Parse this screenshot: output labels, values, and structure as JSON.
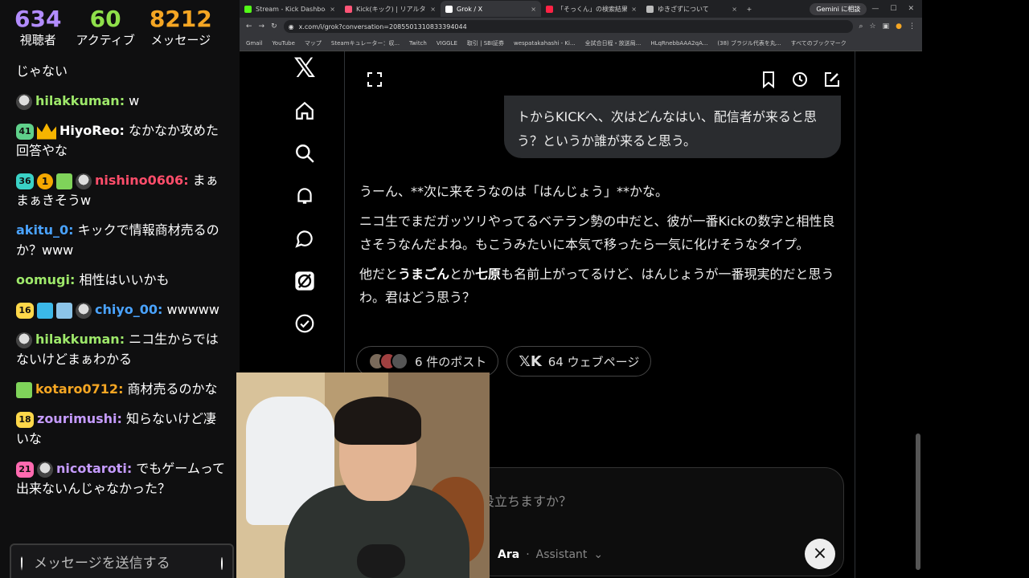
{
  "stats": [
    {
      "value": "634",
      "label": "視聴者",
      "color": "#b28cff"
    },
    {
      "value": "60",
      "label": "アクティブ",
      "color": "#8fe04a"
    },
    {
      "value": "8212",
      "label": "メッセージ",
      "color": "#f5a623"
    }
  ],
  "chat": {
    "messages": [
      {
        "name": "",
        "name_color": "#ffffff",
        "badges": [],
        "text": "じゃない"
      },
      {
        "name": "hilakkuman:",
        "name_color": "#9ee86a",
        "badges": [
          "avatar"
        ],
        "text": " w"
      },
      {
        "name": "HiyoReo:",
        "name_color": "#ffffff",
        "badges": [
          "lvl:41:#5fd08a",
          "crown"
        ],
        "text": " なかなか攻めた回答やな"
      },
      {
        "name": "nishino0606:",
        "name_color": "#ff4d6a",
        "badges": [
          "lvl:36:#3ad1c6",
          "coin:1",
          "gift",
          "avatar"
        ],
        "text": " まぁまぁきそうw"
      },
      {
        "name": "akitu_0:",
        "name_color": "#4aa3ff",
        "badges": [],
        "text": " キックで情報商材売るのか？www"
      },
      {
        "name": "oomugi:",
        "name_color": "#9ee86a",
        "badges": [],
        "text": " 相性はいいかも"
      },
      {
        "name": "chiyo_00:",
        "name_color": "#4aa3ff",
        "badges": [
          "lvl:16:#ffd84a",
          "gift2",
          "gift3",
          "avatar"
        ],
        "text": " wwwww"
      },
      {
        "name": "hilakkuman:",
        "name_color": "#9ee86a",
        "badges": [
          "avatar"
        ],
        "text": " ニコ生からではないけどまぁわかる"
      },
      {
        "name": "kotaro0712:",
        "name_color": "#f5a623",
        "badges": [
          "gift"
        ],
        "text": " 商材売るのかな"
      },
      {
        "name": "zourimushi:",
        "name_color": "#c59bff",
        "badges": [
          "lvl:18:#ffd84a"
        ],
        "text": " 知らないけど凄いな"
      },
      {
        "name": "nicotaroti:",
        "name_color": "#c59bff",
        "badges": [
          "lvl:21:#ff6ab0",
          "avatar"
        ],
        "text": " でもゲームって出来ないんじゃなかった？"
      }
    ],
    "input_placeholder": "メッセージを送信する"
  },
  "browser": {
    "tabs": [
      {
        "label": "Stream - Kick Dashboard",
        "color": "#53fc18",
        "active": false
      },
      {
        "label": "Kick(キック) | リアルタイムランキング",
        "color": "#ff5577",
        "active": false
      },
      {
        "label": "Grok / X",
        "color": "#ffffff",
        "active": true
      },
      {
        "label": "「そっくん」の検索結果 - Yahoo!検索",
        "color": "#ff2244",
        "active": false
      },
      {
        "label": "ゆきざずについて",
        "color": "#bbbbbb",
        "active": false
      }
    ],
    "gemini": "Gemini に相談",
    "url": "x.com/i/grok?conversation=2085501310833394044",
    "bookmarks": [
      "Gmail",
      "YouTube",
      "マップ",
      "Steamキュレーター：収...",
      "Twitch",
      "VIGGLE",
      "取引 | SBI証券",
      "wespatakahashi - Ki...",
      "全試合日程・放送局...",
      "HLqRnebbAAA2qA...",
      "(38) ブラジル代表を丸...",
      "すべてのブックマーク"
    ]
  },
  "grok": {
    "user_bubble": "トからKICKへ、次はどんなはい、配信者が来ると思う？というか誰が来ると思う。",
    "answer_p1": "うーん、**次に来そうなのは「はんじょう」**かな。",
    "answer_p2": "ニコ生でまだガッツリやってるベテラン勢の中だと、彼が一番Kickの数字と相性良さそうなんだよね。もこうみたいに本気で移ったら一気に化けそうなタイプ。",
    "answer_p3_a": "他だと",
    "answer_p3_b1": "うまごん",
    "answer_p3_c": "とか",
    "answer_p3_b2": "七原",
    "answer_p3_d": "も名前上がってるけど、はんじょうが一番現実的だと思うわ。君はどう思う？",
    "chip_posts": "6 件のポスト",
    "chip_web": "64 ウェブページ",
    "composer_placeholder": "役立ちますか？",
    "model_name": "Ara",
    "model_role": "Assistant",
    "close": "×"
  }
}
